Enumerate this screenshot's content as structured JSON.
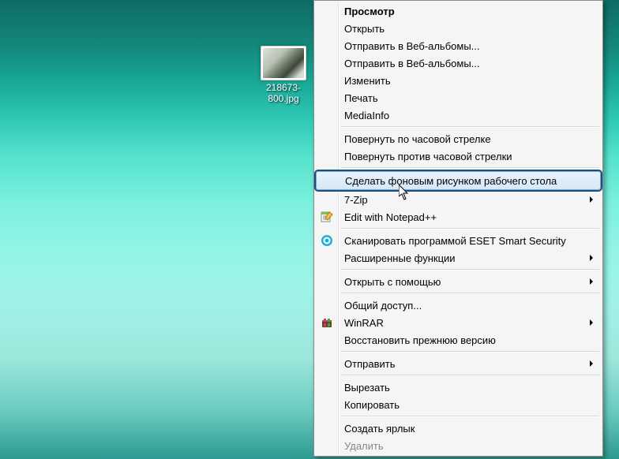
{
  "desktop": {
    "file": {
      "label": "218673-\n800.jpg"
    }
  },
  "menu": {
    "header": "Просмотр",
    "items": [
      {
        "label": "Открыть"
      },
      {
        "label": "Отправить в Веб-альбомы..."
      },
      {
        "label": "Отправить в Веб-альбомы..."
      },
      {
        "label": "Изменить"
      },
      {
        "label": "Печать"
      },
      {
        "label": "MediaInfo"
      },
      {
        "sep": true
      },
      {
        "label": "Повернуть по часовой стрелке"
      },
      {
        "label": "Повернуть против часовой стрелки"
      },
      {
        "sep": true
      },
      {
        "label": "Сделать фоновым рисунком рабочего стола",
        "highlight": true
      },
      {
        "label": "7-Zip",
        "submenu": true
      },
      {
        "label": "Edit with Notepad++",
        "icon": "notepad-icon"
      },
      {
        "sep": true
      },
      {
        "label": "Сканировать программой ESET Smart Security",
        "icon": "eset-icon"
      },
      {
        "label": "Расширенные функции",
        "submenu": true
      },
      {
        "sep": true
      },
      {
        "label": "Открыть с помощью",
        "submenu": true
      },
      {
        "sep": true
      },
      {
        "label": "Общий доступ..."
      },
      {
        "label": "WinRAR",
        "submenu": true,
        "icon": "winrar-icon"
      },
      {
        "label": "Восстановить прежнюю версию"
      },
      {
        "sep": true
      },
      {
        "label": "Отправить",
        "submenu": true
      },
      {
        "sep": true
      },
      {
        "label": "Вырезать"
      },
      {
        "label": "Копировать"
      },
      {
        "sep": true
      },
      {
        "label": "Создать ярлык"
      },
      {
        "label": "Удалить"
      }
    ]
  }
}
